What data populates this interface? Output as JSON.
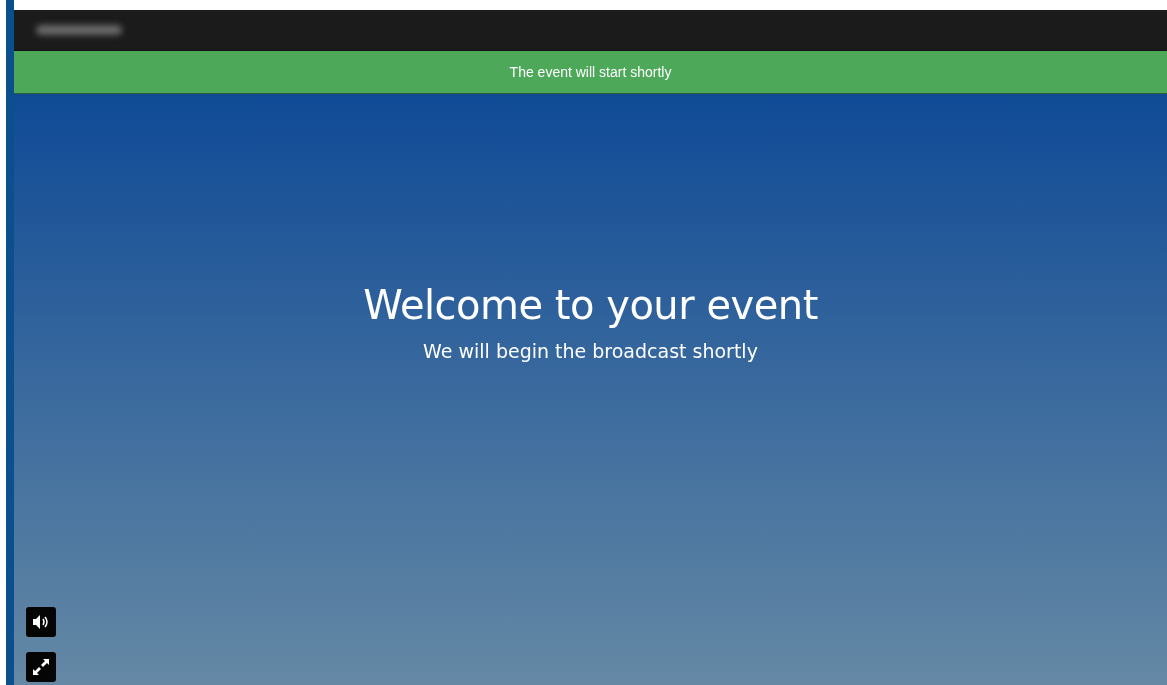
{
  "banner": {
    "message": "The event will start shortly"
  },
  "stage": {
    "title": "Welcome to your event",
    "subtitle": "We will begin the broadcast shortly"
  },
  "controls": [
    {
      "kind": "volume"
    },
    {
      "kind": "fullscreen"
    }
  ]
}
